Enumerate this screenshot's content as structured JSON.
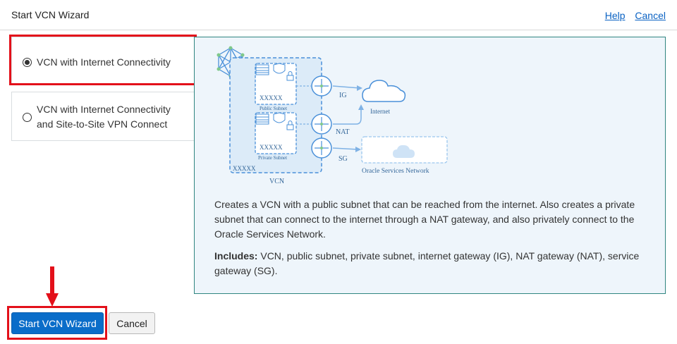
{
  "header": {
    "title": "Start VCN Wizard",
    "help_link": "Help",
    "cancel_link": "Cancel"
  },
  "options": [
    {
      "label": "VCN with Internet Connectivity",
      "selected": true
    },
    {
      "label": "VCN with Internet Connectivity and Site-to-Site VPN Connect",
      "selected": false
    }
  ],
  "diagram": {
    "public_subnet": "Public Subnet",
    "private_subnet": "Private Subnet",
    "cidr_public": "XXXXX",
    "cidr_private": "XXXXX",
    "cidr_vcn": "XXXXX",
    "vcn": "VCN",
    "ig": "IG",
    "nat": "NAT",
    "sg": "SG",
    "internet": "Internet",
    "oracle_services_network": "Oracle Services Network"
  },
  "description": {
    "text": "Creates a VCN with a public subnet that can be reached from the internet. Also creates a private subnet that can connect to the internet through a NAT gateway, and also privately connect to the Oracle Services Network.",
    "includes_label": "Includes:",
    "includes_text": " VCN, public subnet, private subnet, internet gateway (IG), NAT gateway (NAT), service gateway (SG)."
  },
  "footer": {
    "start_button": "Start VCN Wizard",
    "cancel_button": "Cancel"
  },
  "colors": {
    "highlight": "#e3101a",
    "primary_button": "#0a6dc9",
    "panel_border": "#2f8580",
    "panel_bg": "#eef5fb",
    "link": "#0a62c3",
    "diagram_blue": "#4a90d9"
  }
}
